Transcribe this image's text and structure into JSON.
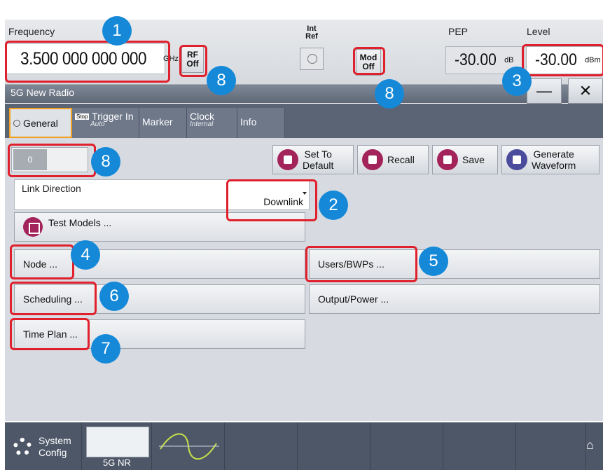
{
  "topbar": {
    "frequency_label": "Frequency",
    "frequency_value": "3.500 000 000 000",
    "frequency_unit": "GHz",
    "rf_label": "RF\nOff",
    "int_ref_label": "Int\nRef",
    "mod_label": "Mod\nOff",
    "pep_label": "PEP",
    "pep_value": "-30.00",
    "pep_unit": "dB",
    "level_label": "Level",
    "level_value": "-30.00",
    "level_unit": "dBm"
  },
  "dialog": {
    "title": "5G New Radio",
    "minimize": "—",
    "close": "✕"
  },
  "tabs": [
    {
      "label": "General",
      "sub": ""
    },
    {
      "label": "Trigger In",
      "sub": "Auto",
      "badge": "Stop"
    },
    {
      "label": "Marker",
      "sub": ""
    },
    {
      "label": "Clock",
      "sub": "Internal"
    },
    {
      "label": "Info",
      "sub": ""
    }
  ],
  "state_toggle": "0",
  "actions": {
    "set_default": "Set To\nDefault",
    "recall": "Recall",
    "save": "Save",
    "generate": "Generate\nWaveform"
  },
  "link_direction": {
    "label": "Link Direction",
    "value": "Downlink"
  },
  "buttons": {
    "test_models": "Test Models ...",
    "node": "Node ...",
    "users": "Users/BWPs ...",
    "scheduling": "Scheduling ...",
    "output_power": "Output/Power ...",
    "time_plan": "Time Plan ..."
  },
  "taskbar": {
    "system_config": "System\nConfig",
    "thumb_label": "5G NR"
  },
  "callouts": [
    "1",
    "2",
    "3",
    "4",
    "5",
    "6",
    "7",
    "8",
    "8",
    "8"
  ],
  "colors": {
    "callout": "#1589d8",
    "highlight": "#e0202c",
    "accent": "#a3245a"
  }
}
